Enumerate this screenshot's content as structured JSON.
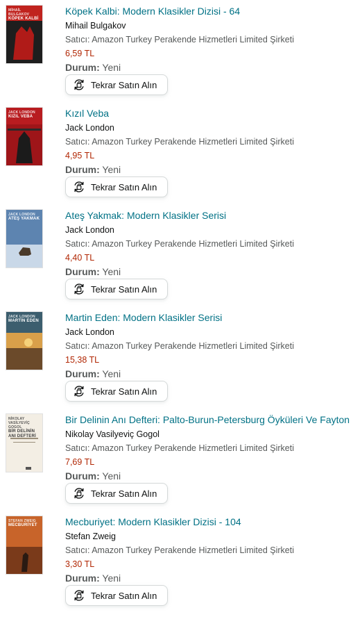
{
  "items": [
    {
      "title": "Köpek Kalbi: Modern Klasikler Dizisi - 64",
      "author": "Mihail Bulgakov",
      "seller": "Satıcı: Amazon Turkey Perakende Hizmetleri Limited Şirketi",
      "price": "6,59 TL",
      "condition_label": "Durum:",
      "condition_value": "Yeni",
      "button_label": "Tekrar Satın Alın",
      "cover": {
        "author": "MİHAİL BULGAKOV",
        "title": "KÖPEK KALBİ",
        "bg": "#c0231e",
        "fg": "#ffffff",
        "art": "dog"
      }
    },
    {
      "title": "Kızıl Veba",
      "author": "Jack London",
      "seller": "Satıcı: Amazon Turkey Perakende Hizmetleri Limited Şirketi",
      "price": "4,95 TL",
      "condition_label": "Durum:",
      "condition_value": "Yeni",
      "button_label": "Tekrar Satın Alın",
      "cover": {
        "author": "JACK LONDON",
        "title": "KIZIL VEBA",
        "bg": "#b81c20",
        "fg": "#ffffff",
        "art": "plague"
      }
    },
    {
      "title": "Ateş Yakmak: Modern Klasikler Serisi",
      "author": "Jack London",
      "seller": "Satıcı: Amazon Turkey Perakende Hizmetleri Limited Şirketi",
      "price": "4,40 TL",
      "condition_label": "Durum:",
      "condition_value": "Yeni",
      "button_label": "Tekrar Satın Alın",
      "cover": {
        "author": "JACK LONDON",
        "title": "ATEŞ YAKMAK",
        "bg": "#5d84b0",
        "fg": "#ffffff",
        "art": "snow"
      }
    },
    {
      "title": "Martin Eden: Modern Klasikler Serisi",
      "author": "Jack London",
      "seller": "Satıcı: Amazon Turkey Perakende Hizmetleri Limited Şirketi",
      "price": "15,38 TL",
      "condition_label": "Durum:",
      "condition_value": "Yeni",
      "button_label": "Tekrar Satın Alın",
      "cover": {
        "author": "JACK LONDON",
        "title": "MARTİN EDEN",
        "bg": "#3c5e6e",
        "fg": "#ffffff",
        "art": "sunset"
      }
    },
    {
      "title": "Bir Delinin Anı Defteri: Palto-Burun-Petersburg Öyküleri Ve Fayton",
      "author": "Nikolay Vasilyeviç Gogol",
      "seller": "Satıcı: Amazon Turkey Perakende Hizmetleri Limited Şirketi",
      "price": "7,69 TL",
      "condition_label": "Durum:",
      "condition_value": "Yeni",
      "button_label": "Tekrar Satın Alın",
      "cover": {
        "author": "NİKOLAY VASİLYEVİÇ GOGOL",
        "title": "BİR DELİNİN ANI DEFTERİ",
        "bg": "#f3eee4",
        "fg": "#3a3a3a",
        "art": "paper"
      }
    },
    {
      "title": "Mecburiyet: Modern Klasikler Dizisi - 104",
      "author": "Stefan Zweig",
      "seller": "Satıcı: Amazon Turkey Perakende Hizmetleri Limited Şirketi",
      "price": "3,30 TL",
      "condition_label": "Durum:",
      "condition_value": "Yeni",
      "button_label": "Tekrar Satın Alın",
      "cover": {
        "author": "STEFAN ZWEIG",
        "title": "MECBURİYET",
        "bg": "#c8642a",
        "fg": "#ffffff",
        "art": "field"
      }
    }
  ],
  "icons": {
    "buy_again": "rebuy-cycle-icon"
  },
  "colors": {
    "link": "#007185",
    "price": "#b12704",
    "muted": "#565959",
    "text": "#0f1111"
  }
}
